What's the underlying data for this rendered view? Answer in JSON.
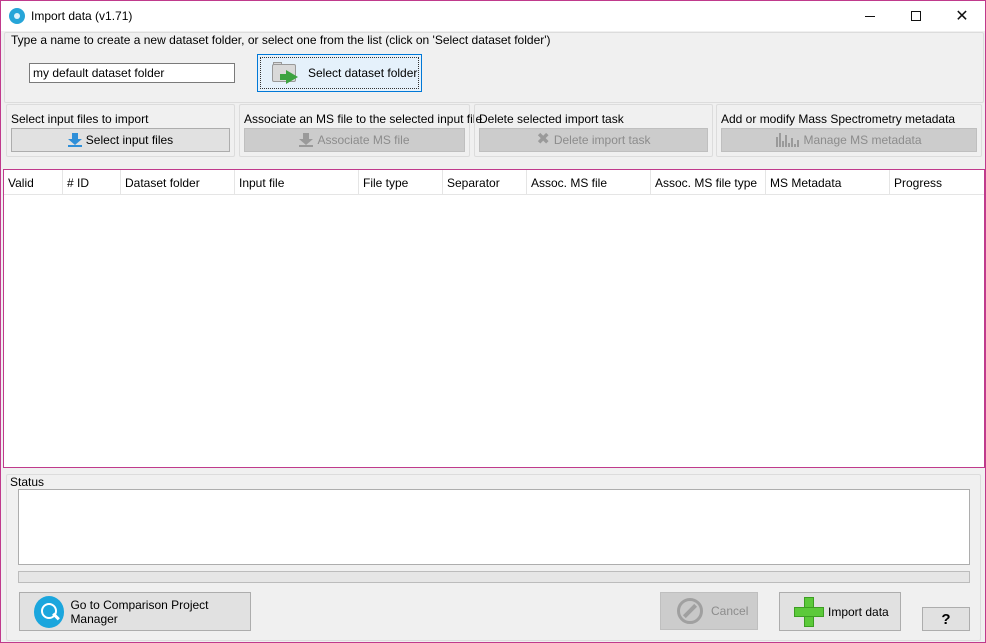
{
  "window": {
    "title": "Import data (v1.71)"
  },
  "dataset": {
    "instruction": "Type a name to create a new dataset folder, or select one from the list (click on 'Select dataset folder')",
    "folder_value": "my default dataset folder",
    "select_button_label": "Select dataset folder"
  },
  "groups": [
    {
      "title": "Select input files to import",
      "button_label": "Select input files",
      "icon": "download-arrow-icon",
      "enabled": true
    },
    {
      "title": "Associate an MS file to the selected input file",
      "button_label": "Associate MS file",
      "icon": "download-arrow-icon",
      "enabled": false
    },
    {
      "title": "Delete selected import task",
      "button_label": "Delete import task",
      "icon": "delete-x-icon",
      "enabled": false
    },
    {
      "title": "Add or modify Mass Spectrometry metadata",
      "button_label": "Manage MS metadata",
      "icon": "spectrum-icon",
      "enabled": false
    }
  ],
  "table": {
    "columns": [
      "Valid",
      "# ID",
      "Dataset folder",
      "Input file",
      "File type",
      "Separator",
      "Assoc. MS file",
      "Assoc. MS file type",
      "MS Metadata",
      "Progress"
    ],
    "rows": []
  },
  "status": {
    "label": "Status",
    "text": "",
    "progress": 0
  },
  "footer": {
    "comparison_label": "Go to Comparison Project Manager",
    "cancel_label": "Cancel",
    "import_label": "Import data",
    "help_label": "?"
  },
  "colors": {
    "accent": "#0078d7",
    "window_border": "#c03a8c",
    "add_green": "#5cc93a",
    "icon_blue": "#2f8fd8"
  }
}
